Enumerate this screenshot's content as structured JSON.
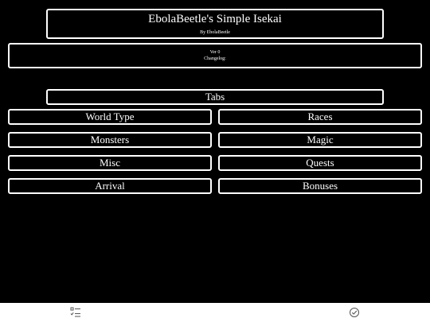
{
  "header": {
    "title": "EbolaBeetle's Simple Isekai",
    "byline": "By EbolaBeetle"
  },
  "changelog": {
    "version": "Ver 0",
    "label": "Changelog:"
  },
  "tabs": {
    "heading": "Tabs",
    "items": [
      {
        "label": "World Type"
      },
      {
        "label": "Races"
      },
      {
        "label": "Monsters"
      },
      {
        "label": "Magic"
      },
      {
        "label": "Misc"
      },
      {
        "label": "Quests"
      },
      {
        "label": "Arrival"
      },
      {
        "label": "Bonuses"
      }
    ]
  },
  "bottom_bar": {
    "left_icon": "checklist-icon",
    "right_icon": "check-circle-icon"
  },
  "colors": {
    "background": "#000000",
    "foreground": "#ffffff",
    "bottom_bar": "#ffffff",
    "icon": "#555555"
  }
}
